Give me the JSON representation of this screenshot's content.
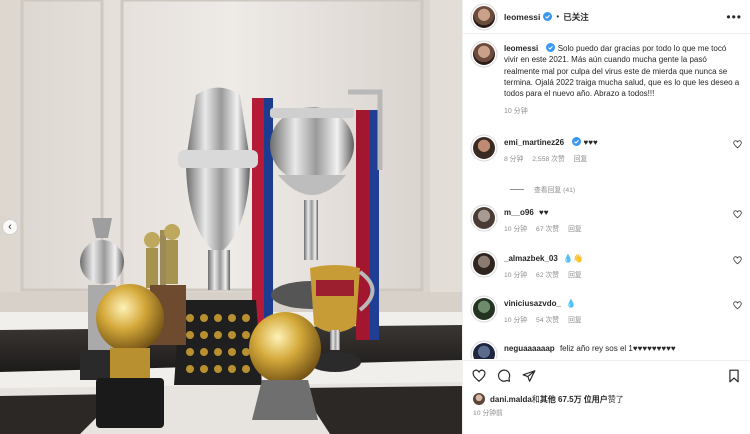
{
  "post": {
    "username": "leomessi",
    "follow_label": "已关注",
    "more_label": "•••",
    "prev_arrow": "‹"
  },
  "caption": {
    "username": "leomessi",
    "text": "Solo puedo dar gracias por todo lo que me tocó vivir en este 2021. Más aún cuando mucha gente la pasó realmente mal por culpa del virus este de mierda que nunca se termina. Ojalá 2022 traiga mucha salud, que es lo que les deseo a todos para el nuevo año. Abrazo a todos!!!",
    "time": "10 分钟"
  },
  "comments": [
    {
      "username": "emi_martinez26",
      "verified": true,
      "text": "♥♥♥",
      "time": "8 分钟",
      "likes": "2,558 次赞",
      "reply": "回复"
    },
    {
      "username": "m__o96",
      "verified": false,
      "text": "♥♥",
      "time": "10 分钟",
      "likes": "67 次赞",
      "reply": "回复"
    },
    {
      "username": "_almazbek_03",
      "verified": false,
      "text": "💧👋",
      "time": "10 分钟",
      "likes": "62 次赞",
      "reply": "回复"
    },
    {
      "username": "viniciusazvdo_",
      "verified": false,
      "text": "💧",
      "time": "10 分钟",
      "likes": "54 次赞",
      "reply": "回复"
    },
    {
      "username": "neguaaaaaap",
      "verified": false,
      "text": "feliz año rey sos el 1♥♥♥♥♥♥♥♥♥",
      "time": "",
      "likes": "",
      "reply": ""
    }
  ],
  "view_replies": "查看回复 (41)",
  "liked_by": {
    "user": "dani.malda",
    "and": " 和 ",
    "others": "其他 67.5万 位用户",
    "suffix": " 赞了"
  },
  "post_time": "10 分钟前",
  "icons": [
    "more-icon",
    "verified-icon",
    "heart-icon",
    "comment-icon",
    "share-icon",
    "save-icon",
    "chevron-left-icon"
  ],
  "colors": {
    "verified": "#3897f0",
    "secondary_text": "#8e8e8e",
    "text": "#262626"
  }
}
